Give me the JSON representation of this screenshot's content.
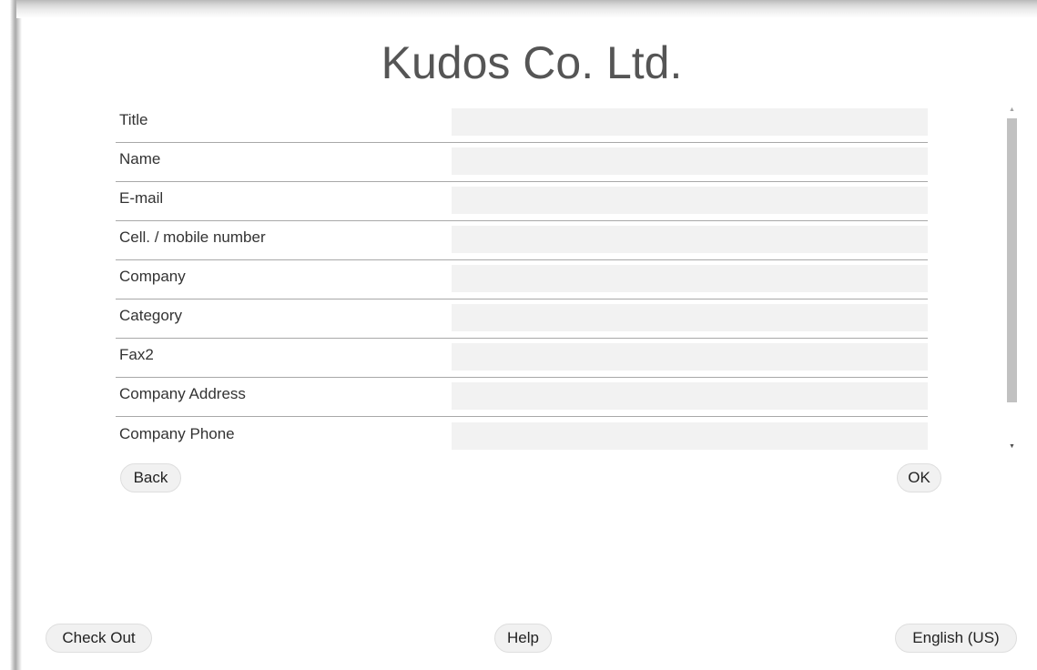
{
  "header": {
    "title": "Kudos Co. Ltd."
  },
  "form": {
    "fields": [
      {
        "label": "Title",
        "value": ""
      },
      {
        "label": "Name",
        "value": ""
      },
      {
        "label": "E-mail",
        "value": ""
      },
      {
        "label": "Cell. / mobile number",
        "value": ""
      },
      {
        "label": "Company",
        "value": ""
      },
      {
        "label": "Category",
        "value": ""
      },
      {
        "label": "Fax2",
        "value": ""
      },
      {
        "label": "Company Address",
        "value": ""
      },
      {
        "label": "Company Phone",
        "value": ""
      }
    ]
  },
  "actions": {
    "back_label": "Back",
    "ok_label": "OK"
  },
  "footer": {
    "checkout_label": "Check Out",
    "help_label": "Help",
    "language_label": "English (US)"
  },
  "scrollbar": {
    "up_icon": "triangle-up-icon",
    "down_icon": "triangle-down-icon"
  },
  "colors": {
    "title": "#555555",
    "field_bg": "#f2f2f2",
    "divider": "#a8a8a8",
    "button_bg": "#f1f1f1"
  }
}
